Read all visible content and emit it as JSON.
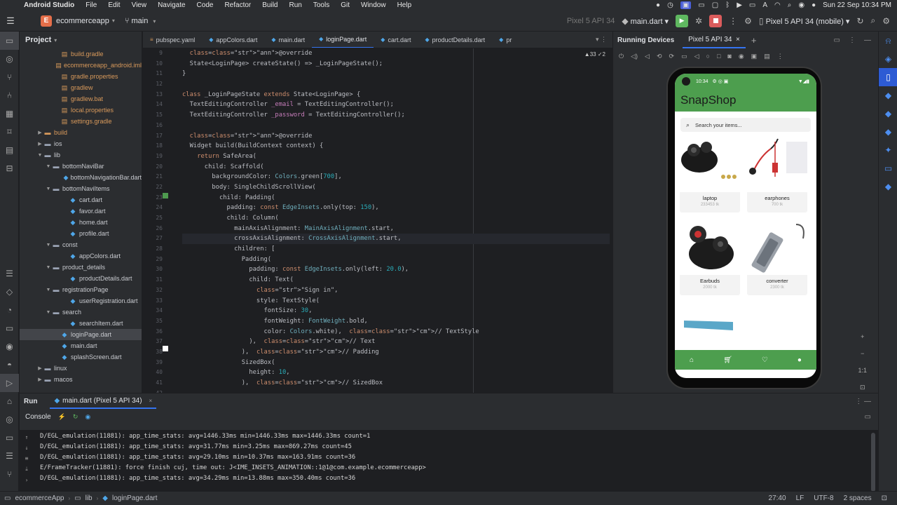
{
  "menubar": {
    "app": "Android Studio",
    "items": [
      "File",
      "Edit",
      "View",
      "Navigate",
      "Code",
      "Refactor",
      "Build",
      "Run",
      "Tools",
      "Git",
      "Window",
      "Help"
    ],
    "datetime": "Sun 22 Sep  10:34 PM"
  },
  "toolbar": {
    "project_badge": "E",
    "project_name": "ecommerceapp",
    "branch": "main",
    "device_dim": "Pixel 5 API 34",
    "run_config": "main.dart",
    "device": "Pixel 5 API 34 (mobile)"
  },
  "project_panel": {
    "title": "Project",
    "tree": [
      {
        "label": "build.gradle",
        "indent": 4,
        "kind": "orange"
      },
      {
        "label": "ecommerceapp_android.iml",
        "indent": 4,
        "kind": "orange"
      },
      {
        "label": "gradle.properties",
        "indent": 4,
        "kind": "orange"
      },
      {
        "label": "gradlew",
        "indent": 4,
        "kind": "orange"
      },
      {
        "label": "gradlew.bat",
        "indent": 4,
        "kind": "orange"
      },
      {
        "label": "local.properties",
        "indent": 4,
        "kind": "orange"
      },
      {
        "label": "settings.gradle",
        "indent": 4,
        "kind": "orange"
      },
      {
        "label": "build",
        "indent": 2,
        "kind": "folder-excl",
        "twisty": "▶"
      },
      {
        "label": "ios",
        "indent": 2,
        "kind": "folder",
        "twisty": "▶"
      },
      {
        "label": "lib",
        "indent": 2,
        "kind": "folder",
        "twisty": "▼"
      },
      {
        "label": "bottomNaviBar",
        "indent": 3,
        "kind": "folder",
        "twisty": "▼"
      },
      {
        "label": "bottomNavigationBar.dart",
        "indent": 5,
        "kind": "dart"
      },
      {
        "label": "bottomNaviItems",
        "indent": 3,
        "kind": "folder",
        "twisty": "▼"
      },
      {
        "label": "cart.dart",
        "indent": 5,
        "kind": "dart"
      },
      {
        "label": "favor.dart",
        "indent": 5,
        "kind": "dart"
      },
      {
        "label": "home.dart",
        "indent": 5,
        "kind": "dart"
      },
      {
        "label": "profile.dart",
        "indent": 5,
        "kind": "dart"
      },
      {
        "label": "const",
        "indent": 3,
        "kind": "folder",
        "twisty": "▼"
      },
      {
        "label": "appColors.dart",
        "indent": 5,
        "kind": "dart"
      },
      {
        "label": "product_details",
        "indent": 3,
        "kind": "folder",
        "twisty": "▼"
      },
      {
        "label": "productDetails.dart",
        "indent": 5,
        "kind": "dart"
      },
      {
        "label": "registrationPage",
        "indent": 3,
        "kind": "folder",
        "twisty": "▼"
      },
      {
        "label": "userRegistration.dart",
        "indent": 5,
        "kind": "dart"
      },
      {
        "label": "search",
        "indent": 3,
        "kind": "folder",
        "twisty": "▼"
      },
      {
        "label": "searchItem.dart",
        "indent": 5,
        "kind": "dart"
      },
      {
        "label": "loginPage.dart",
        "indent": 4,
        "kind": "dart",
        "selected": true
      },
      {
        "label": "main.dart",
        "indent": 4,
        "kind": "dart"
      },
      {
        "label": "splashScreen.dart",
        "indent": 4,
        "kind": "dart"
      },
      {
        "label": "linux",
        "indent": 2,
        "kind": "folder",
        "twisty": "▶"
      },
      {
        "label": "macos",
        "indent": 2,
        "kind": "folder",
        "twisty": "▶"
      }
    ]
  },
  "editor": {
    "tabs": [
      {
        "label": "pubspec.yaml",
        "kind": "pubspec"
      },
      {
        "label": "appColors.dart"
      },
      {
        "label": "main.dart"
      },
      {
        "label": "loginPage.dart",
        "active": true
      },
      {
        "label": "cart.dart"
      },
      {
        "label": "productDetails.dart"
      },
      {
        "label": "pr"
      }
    ],
    "warnings": "▲33  ✓2",
    "line_numbers": [
      "9",
      "10",
      "11",
      "12",
      "13",
      "14",
      "15",
      "16",
      "17",
      "18",
      "19",
      "20",
      "21",
      "22",
      "23",
      "24",
      "25",
      "26",
      "27",
      "28",
      "29",
      "30",
      "31",
      "32",
      "33",
      "34",
      "35",
      "36",
      "37",
      "38",
      "39",
      "40",
      "41",
      "42"
    ],
    "code": [
      "  @override",
      "  State<LoginPage> createState() => _LoginPageState();",
      "}",
      "",
      "class _LoginPageState extends State<LoginPage> {",
      "  TextEditingController _email = TextEditingController();",
      "  TextEditingController _password = TextEditingController();",
      "",
      "  @override",
      "  Widget build(BuildContext context) {",
      "    return SafeArea(",
      "      child: Scaffold(",
      "        backgroundColor: Colors.green[700],",
      "        body: SingleChildScrollView(",
      "          child: Padding(",
      "            padding: const EdgeInsets.only(top: 150),",
      "            child: Column(",
      "              mainAxisAlignment: MainAxisAlignment.start,",
      "              crossAxisAlignment: CrossAxisAlignment.start,",
      "              children: [",
      "                Padding(",
      "                  padding: const EdgeInsets.only(left: 20.0),",
      "                  child: Text(",
      "                    \"Sign in\",",
      "                    style: TextStyle(",
      "                      fontSize: 30,",
      "                      fontWeight: FontWeight.bold,",
      "                      color: Colors.white),  // TextStyle",
      "                  ),  // Text",
      "                ),  // Padding",
      "                SizedBox(",
      "                  height: 10,",
      "                ),  // SizedBox"
    ]
  },
  "devices": {
    "title": "Running Devices",
    "tab": "Pixel 5 API 34",
    "phone": {
      "time": "10:34",
      "app_title": "SnapShop",
      "search_placeholder": "Search your items...",
      "products": [
        {
          "name": "laptop",
          "price": "233453 tk"
        },
        {
          "name": "earphones",
          "price": "700 tk"
        },
        {
          "name": "Earbuds",
          "price": "2000 tk"
        },
        {
          "name": "converter",
          "price": "2300 tk"
        }
      ]
    },
    "zoom": "1:1"
  },
  "run_panel": {
    "title": "Run",
    "tab": "main.dart (Pixel 5 API 34)",
    "console_label": "Console",
    "logs": [
      "D/EGL_emulation(11881): app_time_stats: avg=1446.33ms min=1446.33ms max=1446.33ms count=1",
      "D/EGL_emulation(11881): app_time_stats: avg=31.77ms min=3.25ms max=869.27ms count=45",
      "D/EGL_emulation(11881): app_time_stats: avg=29.10ms min=10.37ms max=163.91ms count=36",
      "E/FrameTracker(11881): force finish cuj, time out: J<IME_INSETS_ANIMATION::1@1@com.example.ecommerceapp>",
      "D/EGL_emulation(11881): app_time_stats: avg=34.29ms min=13.88ms max=350.40ms count=36"
    ]
  },
  "statusbar": {
    "crumbs": [
      "ecommerceApp",
      "lib",
      "loginPage.dart"
    ],
    "position": "27:40",
    "line_sep": "LF",
    "encoding": "UTF-8",
    "indent": "2 spaces"
  }
}
